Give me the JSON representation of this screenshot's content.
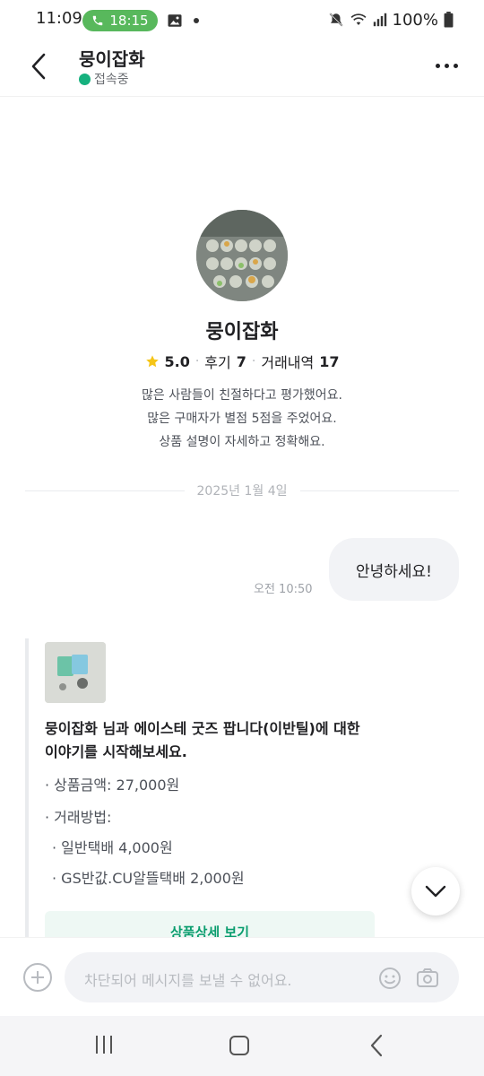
{
  "status_bar": {
    "time": "11:09",
    "call_timer": "18:15",
    "battery": "100%",
    "icons": [
      "phone-icon",
      "gallery-icon",
      "mute-icon",
      "wifi-icon",
      "signal-icon",
      "battery-icon"
    ]
  },
  "header": {
    "title": "뭉이잡화",
    "status": "접속중",
    "status_color": "#16b17e"
  },
  "profile": {
    "name": "뭉이잡화",
    "rating": "5.0",
    "reviews_label": "후기",
    "reviews_count": "7",
    "trades_label": "거래내역",
    "trades_count": "17",
    "review_lines": [
      "많은 사람들이 친절하다고 평가했어요.",
      "많은 구매자가 별점 5점을 주었어요.",
      "상품 설명이 자세하고 정확해요."
    ]
  },
  "chat": {
    "date": "2025년 1월 4일",
    "messages": [
      {
        "text": "안녕하세요!",
        "time": "오전 10:50"
      }
    ],
    "card": {
      "intro": "뭉이잡화 님과 에이스테 굿즈 팝니다(이반틸)에 대한 이야기를 시작해보세요.",
      "price": "· 상품금액: 27,000원",
      "method_label": "· 거래방법:",
      "methods": [
        "· 일반택배 4,000원",
        "· GS반값.CU알뜰택배 2,000원"
      ],
      "detail_button": "상품상세 보기"
    }
  },
  "input": {
    "placeholder": "차단되어 메시지를 보낼 수 없어요."
  },
  "colors": {
    "accent": "#16b17e",
    "call_pill": "#58b85c",
    "bubble": "#f2f3f6"
  }
}
